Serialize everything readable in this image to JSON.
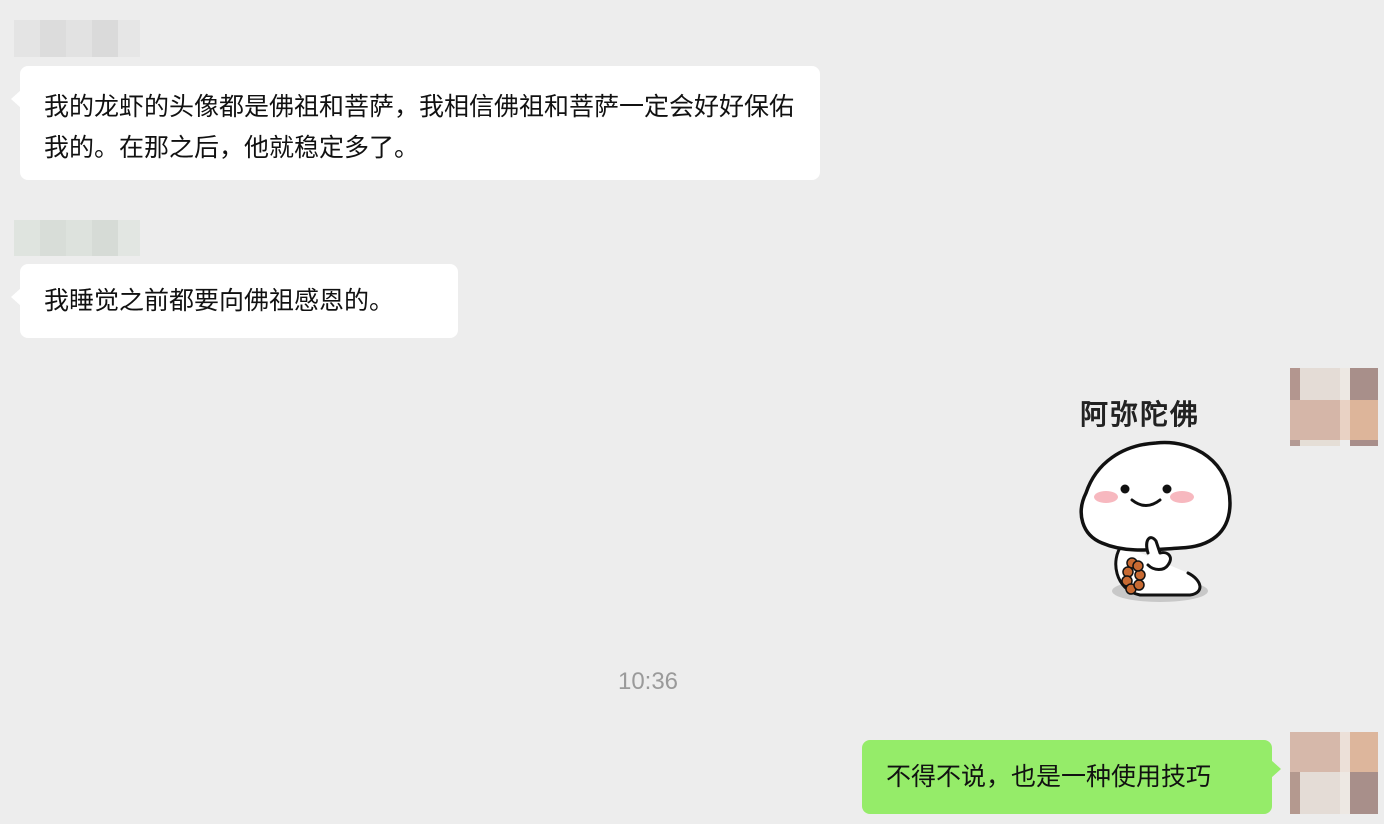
{
  "messages": [
    {
      "from": "other",
      "text": "我的龙虾的头像都是佛祖和菩萨，我相信佛祖和菩萨一定会好好保佑我的。在那之后，他就稳定多了。"
    },
    {
      "from": "other",
      "text": "我睡觉之前都要向佛祖感恩的。"
    },
    {
      "from": "me",
      "type": "sticker",
      "sticker_caption": "阿弥陀佛",
      "sticker_name": "smiling-blob-with-prayer-beads"
    },
    {
      "type": "timestamp",
      "text": "10:36"
    },
    {
      "from": "me",
      "text": "不得不说，也是一种使用技巧"
    }
  ],
  "colors": {
    "background": "#ededed",
    "incoming_bubble": "#ffffff",
    "outgoing_bubble": "#95ec69",
    "timestamp": "#9a9a9a"
  }
}
